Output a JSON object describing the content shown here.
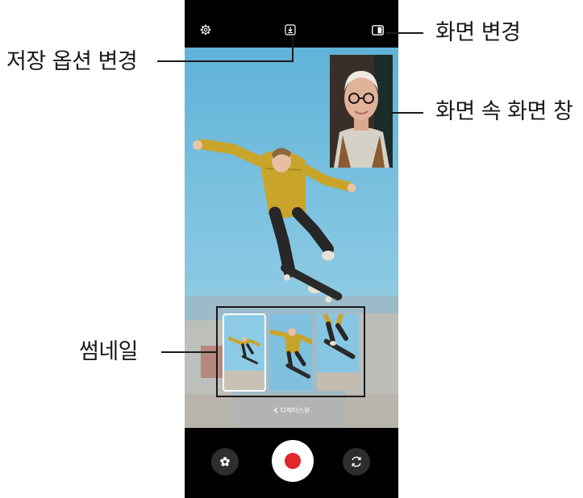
{
  "callouts": {
    "save_options": "저장 옵션 변경",
    "change_screen": "화면 변경",
    "picture_in_picture": "화면 속 화면 창",
    "thumbnail": "썸네일"
  },
  "viewfinder": {
    "mode_label": "디렉터스뷰",
    "mode_back_icon": "chevron-left-icon"
  },
  "icons": {
    "settings": "gear-icon",
    "save_options": "download-icon",
    "change_screen": "split-screen-icon",
    "effects": "flower-effects-icon",
    "switch_camera": "rotate-camera-icon"
  },
  "colors": {
    "record": "#e2262a",
    "sky": "#7fc3df",
    "hoodie": "#c9a42a"
  }
}
